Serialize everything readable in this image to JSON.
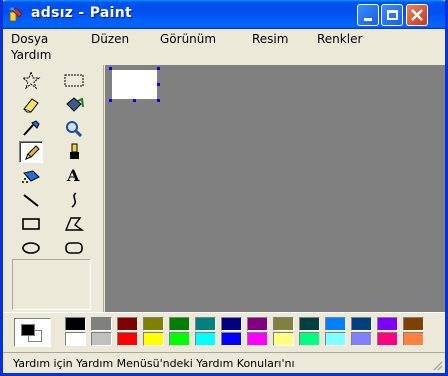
{
  "window": {
    "title": "adsız - Paint"
  },
  "menu": {
    "items": [
      "Dosya",
      "Düzen",
      "Görünüm",
      "Resim",
      "Renkler",
      "Yardım"
    ]
  },
  "tools": [
    {
      "name": "free-form-select",
      "icon": "star-select-icon"
    },
    {
      "name": "select",
      "icon": "rect-select-icon"
    },
    {
      "name": "eraser",
      "icon": "eraser-icon"
    },
    {
      "name": "fill",
      "icon": "fill-bucket-icon"
    },
    {
      "name": "pick-color",
      "icon": "eyedropper-icon"
    },
    {
      "name": "magnifier",
      "icon": "magnifier-icon"
    },
    {
      "name": "pencil",
      "icon": "pencil-icon",
      "selected": true
    },
    {
      "name": "brush",
      "icon": "brush-icon"
    },
    {
      "name": "airbrush",
      "icon": "airbrush-icon"
    },
    {
      "name": "text",
      "icon": "text-icon",
      "glyph": "A"
    },
    {
      "name": "line",
      "icon": "line-icon"
    },
    {
      "name": "curve",
      "icon": "curve-icon"
    },
    {
      "name": "rectangle",
      "icon": "rectangle-icon"
    },
    {
      "name": "polygon",
      "icon": "polygon-icon"
    },
    {
      "name": "ellipse",
      "icon": "ellipse-icon"
    },
    {
      "name": "rounded-rectangle",
      "icon": "rounded-rectangle-icon"
    }
  ],
  "palette": {
    "foreground": "#000000",
    "background": "#ffffff",
    "top_row": [
      "#000000",
      "#808080",
      "#800000",
      "#808000",
      "#008000",
      "#008080",
      "#000080",
      "#800080",
      "#808040",
      "#004040",
      "#0080ff",
      "#004080",
      "#8000ff",
      "#804000"
    ],
    "bottom_row": [
      "#ffffff",
      "#c0c0c0",
      "#ff0000",
      "#ffff00",
      "#00ff00",
      "#00ffff",
      "#0000ff",
      "#ff00ff",
      "#ffff80",
      "#00ff80",
      "#80ffff",
      "#8080ff",
      "#ff0080",
      "#ff8040"
    ]
  },
  "status": {
    "text": "Yardım için Yardım Menüsü'ndeki Yardım Konuları'nı"
  }
}
